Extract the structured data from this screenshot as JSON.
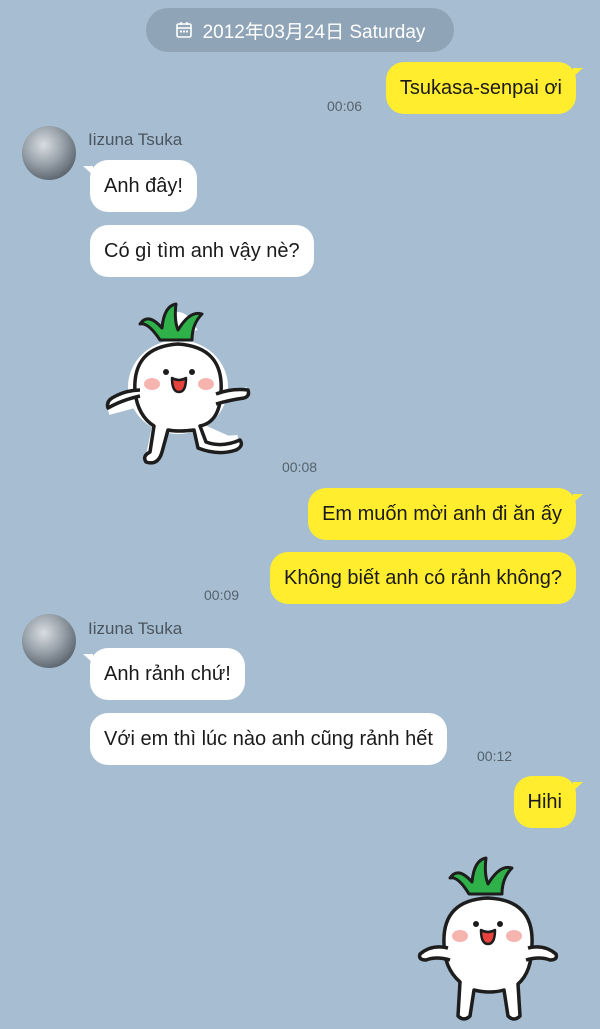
{
  "date_header": {
    "icon": "calendar-icon",
    "text": "2012年03月24日 Saturday"
  },
  "colors": {
    "background": "#a7bdd1",
    "outgoing_bubble": "#ffed2e",
    "incoming_bubble": "#ffffff",
    "date_pill": "#8fa4b6"
  },
  "messages": [
    {
      "dir": "out",
      "text": "Tsukasa-senpai ơi",
      "time": "00:06"
    },
    {
      "dir": "in",
      "sender": "Iizuna Tsuka",
      "text": "Anh đây!"
    },
    {
      "dir": "in",
      "text": "Có gì tìm anh vậy nè?"
    },
    {
      "dir": "in",
      "sticker": "radish-sticker",
      "time": "00:08"
    },
    {
      "dir": "out",
      "text": "Em muốn mời anh đi ăn ấy"
    },
    {
      "dir": "out",
      "text": "Không biết anh có rảnh không?",
      "time": "00:09"
    },
    {
      "dir": "in",
      "sender": "Iizuna Tsuka",
      "text": "Anh rảnh chứ!"
    },
    {
      "dir": "in",
      "text": "Với em thì lúc nào anh cũng rảnh hết",
      "time": "00:12"
    },
    {
      "dir": "out",
      "text": "Hihi"
    },
    {
      "dir": "out",
      "sticker": "radish-sticker"
    }
  ]
}
